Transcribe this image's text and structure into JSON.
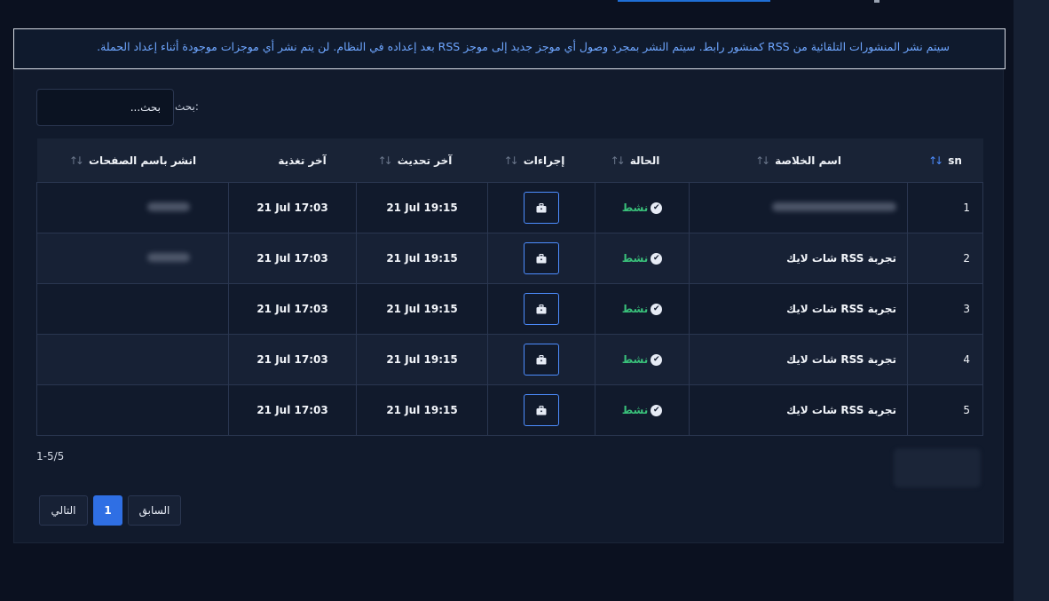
{
  "notice": "سيتم نشر المنشورات التلقائية من RSS كمنشور رابط. سيتم النشر بمجرد وصول أي موجز جديد إلى موجز RSS بعد إعداده في النظام. لن يتم نشر أي موجزات موجودة أثناء إعداد الحملة.",
  "search": {
    "label": "بحث:",
    "placeholder": "بحث..."
  },
  "table": {
    "columns": [
      "sn",
      "اسم الخلاصة",
      "الحالة",
      "إجراءات",
      "آخر تحديث",
      "آخر تغذية",
      "انشر باسم الصفحات"
    ],
    "rows": [
      {
        "sn": "1",
        "name": "",
        "status": "نشط",
        "updated": "21 Jul 19:15",
        "fed": "21 Jul 17:03",
        "pages": ""
      },
      {
        "sn": "2",
        "name": "تجربة RSS شات لايك",
        "status": "نشط",
        "updated": "21 Jul 19:15",
        "fed": "21 Jul 17:03",
        "pages": ""
      },
      {
        "sn": "3",
        "name": "تجربة RSS شات لايك",
        "status": "نشط",
        "updated": "21 Jul 19:15",
        "fed": "21 Jul 17:03",
        "pages": ""
      },
      {
        "sn": "4",
        "name": "تجربة RSS شات لايك",
        "status": "نشط",
        "updated": "21 Jul 19:15",
        "fed": "21 Jul 17:03",
        "pages": ""
      },
      {
        "sn": "5",
        "name": "تجربة RSS شات لايك",
        "status": "نشط",
        "updated": "21 Jul 19:15",
        "fed": "21 Jul 17:03",
        "pages": ""
      }
    ]
  },
  "pagination": {
    "range": "1-5/5",
    "prev": "السابق",
    "current": "1",
    "next": "التالي"
  },
  "colors": {
    "accent": "#2f6fe4",
    "active_status": "#39c07a",
    "notice_text": "#6ea6ff",
    "background": "#0b1120"
  },
  "icons": {
    "sort": "sort-arrows-icon",
    "sort_active": "sort-up-icon",
    "check": "check-circle-icon",
    "action": "briefcase-icon"
  }
}
